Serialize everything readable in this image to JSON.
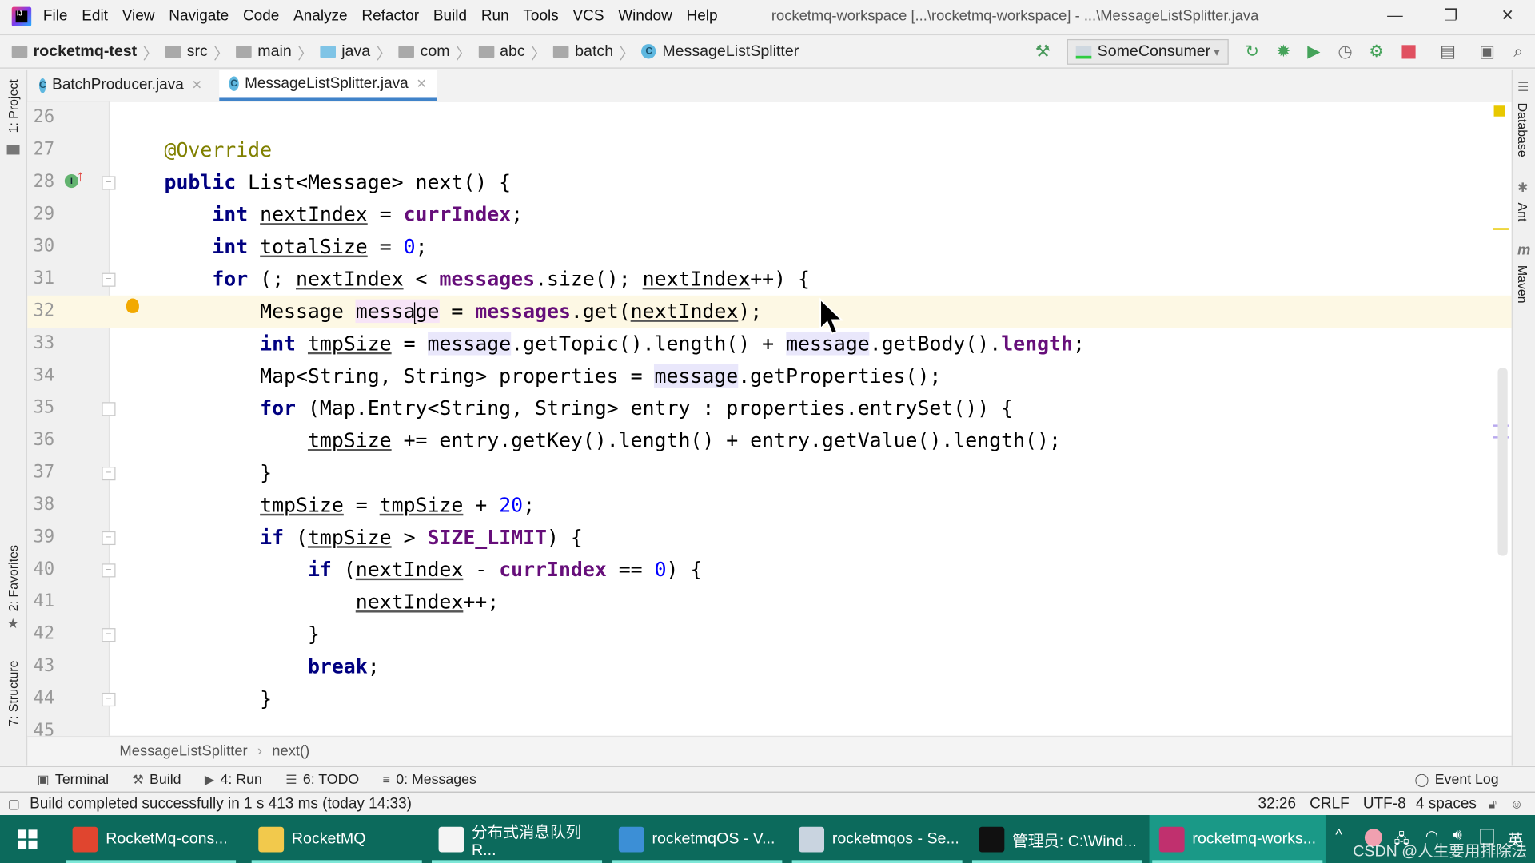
{
  "window": {
    "title": "rocketmq-workspace [...\\rocketmq-workspace] - ...\\MessageListSplitter.java",
    "menu": [
      "File",
      "Edit",
      "View",
      "Navigate",
      "Code",
      "Analyze",
      "Refactor",
      "Build",
      "Run",
      "Tools",
      "VCS",
      "Window",
      "Help"
    ],
    "controls": {
      "minimize": "—",
      "restore": "❐",
      "close": "✕"
    }
  },
  "navbar": {
    "breadcrumbs": [
      "rocketmq-test",
      "src",
      "main",
      "java",
      "com",
      "abc",
      "batch",
      "MessageListSplitter"
    ],
    "run_config": "SomeConsumer"
  },
  "tabs": [
    {
      "label": "BatchProducer.java",
      "active": false
    },
    {
      "label": "MessageListSplitter.java",
      "active": true
    }
  ],
  "left_tools": [
    "1: Project",
    "2: Favorites",
    "7: Structure"
  ],
  "right_tools": [
    "Database",
    "Ant",
    "Maven"
  ],
  "editor": {
    "current_line": 32,
    "lines": [
      {
        "n": "26",
        "tokens": []
      },
      {
        "n": "27",
        "tokens": [
          [
            "    ",
            "p"
          ],
          [
            "@Override",
            "a"
          ]
        ]
      },
      {
        "n": "28",
        "tokens": [
          [
            "    ",
            "p"
          ],
          [
            "public",
            "k"
          ],
          [
            " List<Message> next() {",
            "p"
          ]
        ]
      },
      {
        "n": "29",
        "tokens": [
          [
            "        ",
            "p"
          ],
          [
            "int",
            "k"
          ],
          [
            " ",
            "p"
          ],
          [
            "nextIndex",
            "u"
          ],
          [
            " = ",
            "p"
          ],
          [
            "currIndex",
            "f"
          ],
          [
            ";",
            "p"
          ]
        ]
      },
      {
        "n": "30",
        "tokens": [
          [
            "        ",
            "p"
          ],
          [
            "int",
            "k"
          ],
          [
            " ",
            "p"
          ],
          [
            "totalSize",
            "u"
          ],
          [
            " = ",
            "p"
          ],
          [
            "0",
            "n"
          ],
          [
            ";",
            "p"
          ]
        ]
      },
      {
        "n": "31",
        "tokens": [
          [
            "        ",
            "p"
          ],
          [
            "for",
            "k"
          ],
          [
            " (; ",
            "p"
          ],
          [
            "nextIndex",
            "u"
          ],
          [
            " < ",
            "p"
          ],
          [
            "messages",
            "f"
          ],
          [
            ".size(); ",
            "p"
          ],
          [
            "nextIndex",
            "u"
          ],
          [
            "++) {",
            "p"
          ]
        ]
      },
      {
        "n": "32",
        "tokens": [
          [
            "            Message ",
            "p"
          ],
          [
            "messa",
            "mw"
          ],
          [
            "|",
            "caret"
          ],
          [
            "ge",
            "mw"
          ],
          [
            " = ",
            "p"
          ],
          [
            "messages",
            "f"
          ],
          [
            ".get(",
            "p"
          ],
          [
            "nextIndex",
            "u"
          ],
          [
            ");",
            "p"
          ]
        ]
      },
      {
        "n": "33",
        "tokens": [
          [
            "            ",
            "p"
          ],
          [
            "int",
            "k"
          ],
          [
            " ",
            "p"
          ],
          [
            "tmpSize",
            "u"
          ],
          [
            " = ",
            "p"
          ],
          [
            "message",
            "m"
          ],
          [
            ".getTopic().length() + ",
            "p"
          ],
          [
            "message",
            "m"
          ],
          [
            ".getBody().",
            "p"
          ],
          [
            "length",
            "f"
          ],
          [
            ";",
            "p"
          ]
        ]
      },
      {
        "n": "34",
        "tokens": [
          [
            "            Map<String, String> properties = ",
            "p"
          ],
          [
            "message",
            "m"
          ],
          [
            ".getProperties();",
            "p"
          ]
        ]
      },
      {
        "n": "35",
        "tokens": [
          [
            "            ",
            "p"
          ],
          [
            "for",
            "k"
          ],
          [
            " (Map.Entry<String, String> entry : properties.entrySet()) {",
            "p"
          ]
        ]
      },
      {
        "n": "36",
        "tokens": [
          [
            "                ",
            "p"
          ],
          [
            "tmpSize",
            "u"
          ],
          [
            " += entry.getKey().length() + entry.getValue().length();",
            "p"
          ]
        ]
      },
      {
        "n": "37",
        "tokens": [
          [
            "            }",
            "p"
          ]
        ]
      },
      {
        "n": "38",
        "tokens": [
          [
            "            ",
            "p"
          ],
          [
            "tmpSize",
            "u"
          ],
          [
            " = ",
            "p"
          ],
          [
            "tmpSize",
            "u"
          ],
          [
            " + ",
            "p"
          ],
          [
            "20",
            "n"
          ],
          [
            ";",
            "p"
          ]
        ]
      },
      {
        "n": "39",
        "tokens": [
          [
            "            ",
            "p"
          ],
          [
            "if",
            "k"
          ],
          [
            " (",
            "p"
          ],
          [
            "tmpSize",
            "u"
          ],
          [
            " > ",
            "p"
          ],
          [
            "SIZE_LIMIT",
            "f"
          ],
          [
            ") {",
            "p"
          ]
        ]
      },
      {
        "n": "40",
        "tokens": [
          [
            "                ",
            "p"
          ],
          [
            "if",
            "k"
          ],
          [
            " (",
            "p"
          ],
          [
            "nextIndex",
            "u"
          ],
          [
            " - ",
            "p"
          ],
          [
            "currIndex",
            "f"
          ],
          [
            " == ",
            "p"
          ],
          [
            "0",
            "n"
          ],
          [
            ") {",
            "p"
          ]
        ]
      },
      {
        "n": "41",
        "tokens": [
          [
            "                    ",
            "p"
          ],
          [
            "nextIndex",
            "u"
          ],
          [
            "++;",
            "p"
          ]
        ]
      },
      {
        "n": "42",
        "tokens": [
          [
            "                }",
            "p"
          ]
        ]
      },
      {
        "n": "43",
        "tokens": [
          [
            "                ",
            "p"
          ],
          [
            "break",
            "k"
          ],
          [
            ";",
            "p"
          ]
        ]
      },
      {
        "n": "44",
        "tokens": [
          [
            "            }",
            "p"
          ]
        ]
      },
      {
        "n": "45",
        "tokens": []
      }
    ],
    "folds": [
      "28",
      "31",
      "35",
      "37",
      "39",
      "40",
      "42",
      "44"
    ],
    "breadcrumb": [
      "MessageListSplitter",
      "next()"
    ]
  },
  "tool_windows": [
    {
      "label": "Terminal",
      "icon": "terminal-icon"
    },
    {
      "label": "Build",
      "icon": "hammer-icon"
    },
    {
      "label": "4: Run",
      "icon": "run-icon"
    },
    {
      "label": "6: TODO",
      "icon": "list-icon"
    },
    {
      "label": "0: Messages",
      "icon": "messages-icon"
    }
  ],
  "event_log": "Event Log",
  "status": {
    "message": "Build completed successfully in 1 s 413 ms (today 14:33)",
    "position": "32:26",
    "line_sep": "CRLF",
    "encoding": "UTF-8",
    "indent": "4 spaces"
  },
  "taskbar": {
    "items": [
      {
        "label": "RocketMq-cons...",
        "color": "#e0452f"
      },
      {
        "label": "RocketMQ",
        "color": "#f2c94c"
      },
      {
        "label": "分布式消息队列R...",
        "color": "#f4f4f4"
      },
      {
        "label": "rocketmqOS - V...",
        "color": "#3c8fd6"
      },
      {
        "label": "rocketmqos - Se...",
        "color": "#c9d4e0"
      },
      {
        "label": "管理员: C:\\Wind...",
        "color": "#111111"
      },
      {
        "label": "rocketmq-works...",
        "color": "#c0306e",
        "active": true
      }
    ],
    "tray_ime": "英",
    "watermark": "CSDN @人生要用排除法"
  }
}
